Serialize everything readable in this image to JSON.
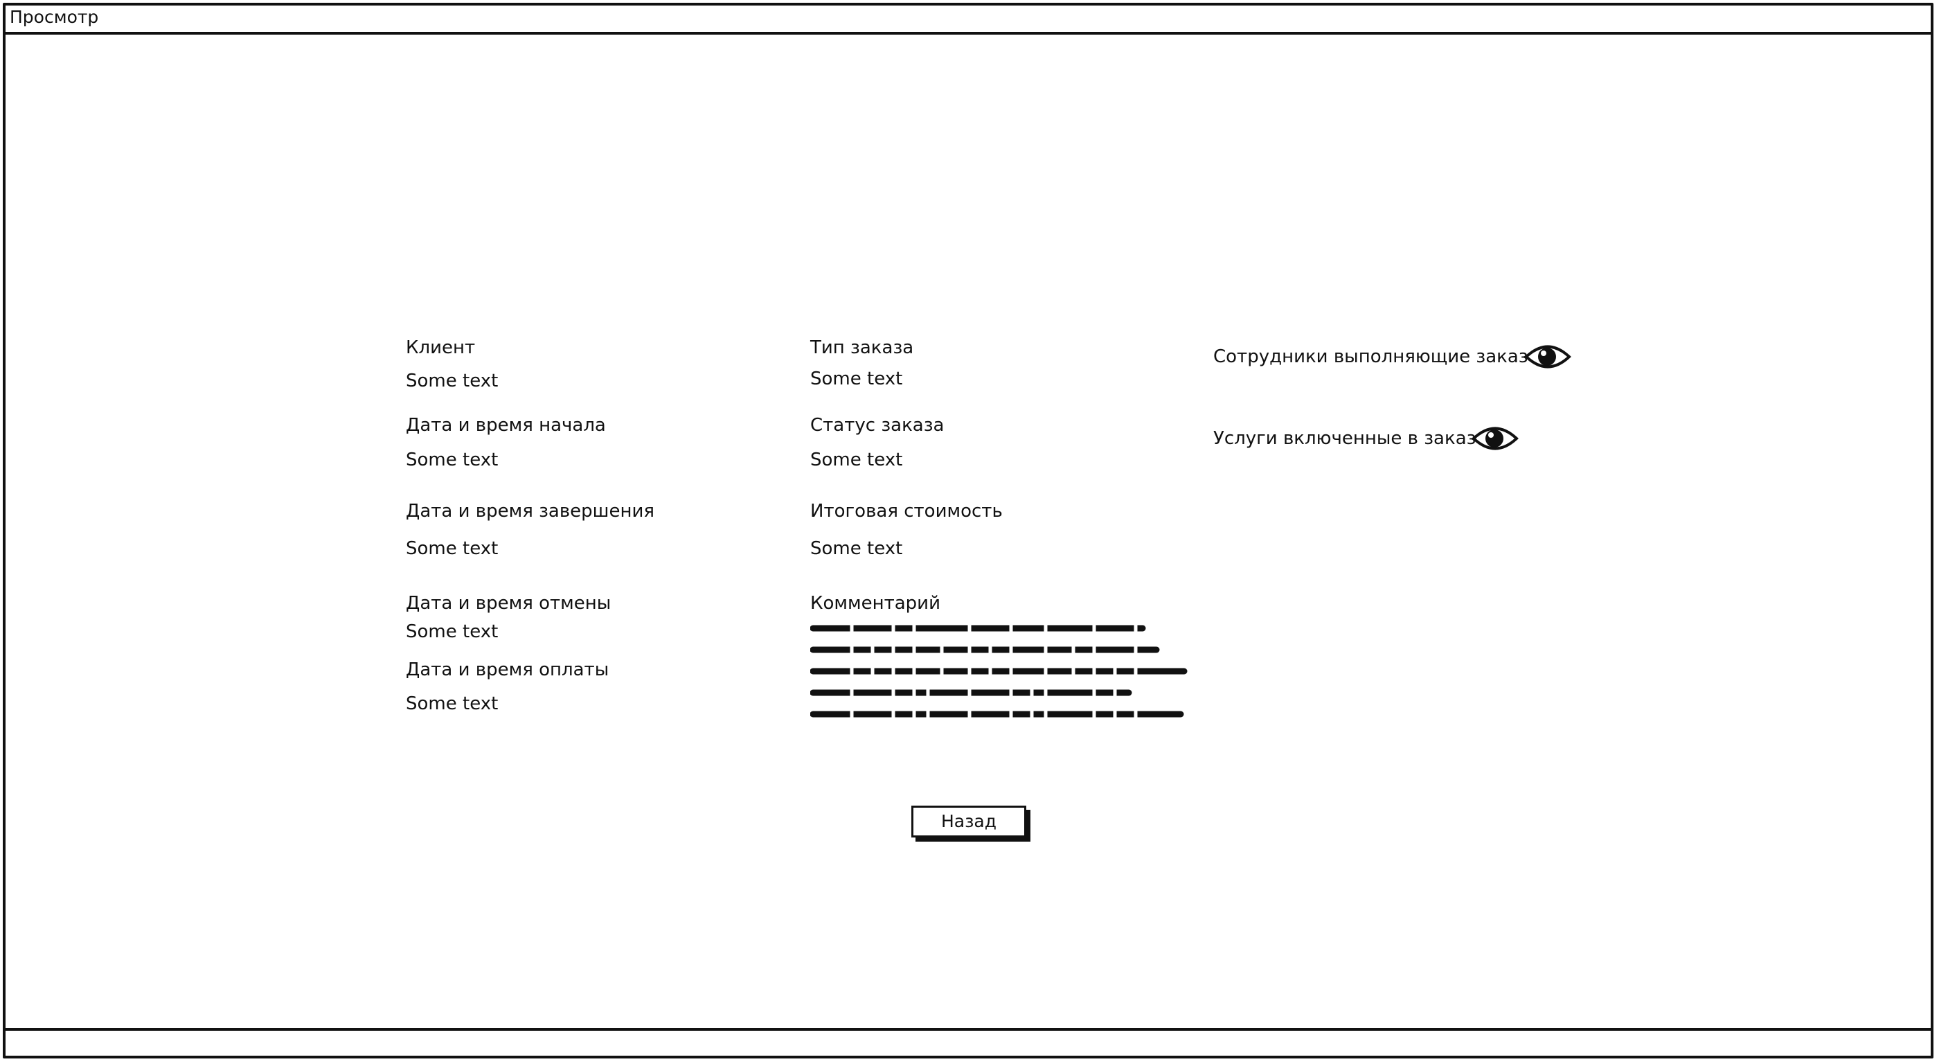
{
  "window": {
    "title": "Просмотр"
  },
  "left_column": [
    {
      "label": "Клиент",
      "value": "Some text"
    },
    {
      "label": "Дата и время начала",
      "value": "Some text"
    },
    {
      "label": "Дата и время завершения",
      "value": "Some text"
    },
    {
      "label": "Дата и время отмены",
      "value": "Some text"
    },
    {
      "label": "Дата и время оплаты",
      "value": "Some text"
    }
  ],
  "middle_column": [
    {
      "label": "Тип заказа",
      "value": "Some text"
    },
    {
      "label": "Статус заказа",
      "value": "Some text"
    },
    {
      "label": "Итоговая стоимость",
      "value": "Some text"
    },
    {
      "label": "Комментарий"
    }
  ],
  "right_column": [
    {
      "label": "Сотрудники выполняющие заказ",
      "icon": "eye-icon"
    },
    {
      "label": "Услуги включенные в заказ",
      "icon": "eye-icon"
    }
  ],
  "actions": {
    "back_label": "Назад"
  }
}
